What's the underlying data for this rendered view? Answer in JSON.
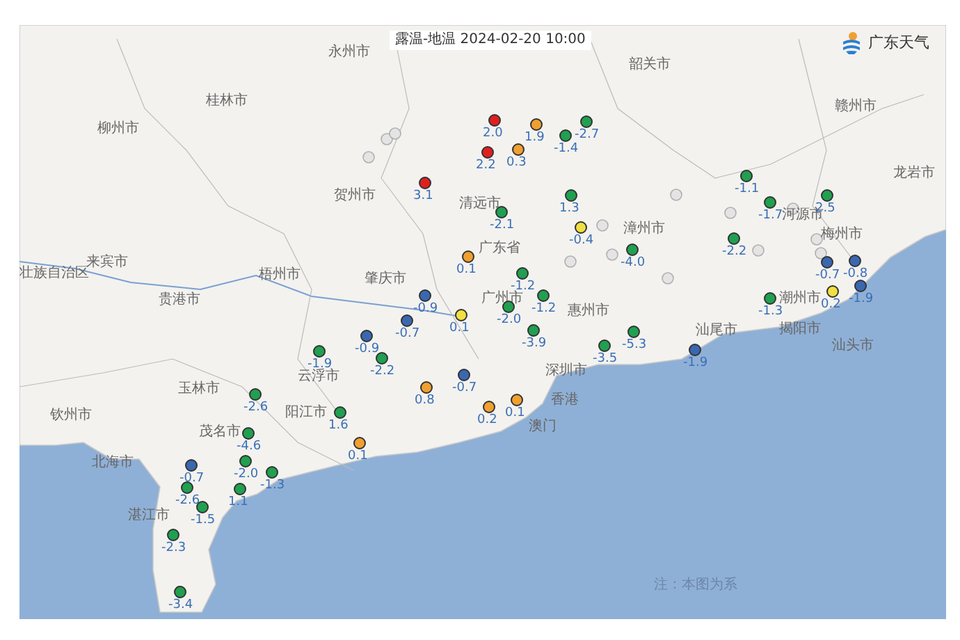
{
  "title": "露温-地温 2024-02-20 10:00",
  "logo": {
    "text": "广东天气"
  },
  "cities": [
    {
      "name": "永州市"
    },
    {
      "name": "桂林市"
    },
    {
      "name": "柳州市"
    },
    {
      "name": "贺州市"
    },
    {
      "name": "来宾市"
    },
    {
      "name": "壮族自治区"
    },
    {
      "name": "梧州市"
    },
    {
      "name": "贵港市"
    },
    {
      "name": "玉林市"
    },
    {
      "name": "钦州市"
    },
    {
      "name": "北海市"
    },
    {
      "name": "茂名市"
    },
    {
      "name": "湛江市"
    },
    {
      "name": "阳江市"
    },
    {
      "name": "云浮市"
    },
    {
      "name": "肇庆市"
    },
    {
      "name": "清远市"
    },
    {
      "name": "广东省"
    },
    {
      "name": "广州市"
    },
    {
      "name": "韶关市"
    },
    {
      "name": "赣州市"
    },
    {
      "name": "龙岩市"
    },
    {
      "name": "漳州市"
    },
    {
      "name": "河源市"
    },
    {
      "name": "梅州市"
    },
    {
      "name": "潮州市"
    },
    {
      "name": "揭阳市"
    },
    {
      "name": "汕头市"
    },
    {
      "name": "惠州市"
    },
    {
      "name": "汕尾市"
    },
    {
      "name": "深圳市"
    },
    {
      "name": "香港"
    },
    {
      "name": "澳门"
    }
  ],
  "stations": [
    {
      "value": "2.0",
      "color": "#e02020"
    },
    {
      "value": "1.9",
      "color": "#f0a030"
    },
    {
      "value": "-1.4",
      "color": "#20a050"
    },
    {
      "value": "-2.7",
      "color": "#20a050"
    },
    {
      "value": "2.2",
      "color": "#e02020"
    },
    {
      "value": "0.3",
      "color": "#f0a030"
    },
    {
      "value": "3.1",
      "color": "#e02020"
    },
    {
      "value": "-2.1",
      "color": "#20a050"
    },
    {
      "value": "1.3",
      "color": "#20a050"
    },
    {
      "value": "-0.4",
      "color": "#f0e040"
    },
    {
      "value": "-4.0",
      "color": "#20a050"
    },
    {
      "value": "-1.1",
      "color": "#20a050"
    },
    {
      "value": "-1.7",
      "color": "#20a050"
    },
    {
      "value": "2.5",
      "color": "#20a050"
    },
    {
      "value": "-2.2",
      "color": "#20a050"
    },
    {
      "value": "-1.3",
      "color": "#20a050"
    },
    {
      "value": "-0.7",
      "color": "#3a68b0"
    },
    {
      "value": "-0.8",
      "color": "#3a68b0"
    },
    {
      "value": "-1.9",
      "color": "#3a68b0"
    },
    {
      "value": "0.2",
      "color": "#f0e040"
    },
    {
      "value": "-1.2",
      "color": "#20a050"
    },
    {
      "value": "-1.2",
      "color": "#20a050"
    },
    {
      "value": "0.1",
      "color": "#f0a030"
    },
    {
      "value": "-0.9",
      "color": "#3a68b0"
    },
    {
      "value": "-0.7",
      "color": "#3a68b0"
    },
    {
      "value": "-0.9",
      "color": "#3a68b0"
    },
    {
      "value": "-1.9",
      "color": "#20a050"
    },
    {
      "value": "-2.2",
      "color": "#20a050"
    },
    {
      "value": "0.8",
      "color": "#f0a030"
    },
    {
      "value": "-0.7",
      "color": "#3a68b0"
    },
    {
      "value": "1.6",
      "color": "#20a050"
    },
    {
      "value": "0.1",
      "color": "#f0a030"
    },
    {
      "value": "-2.6",
      "color": "#20a050"
    },
    {
      "value": "-4.6",
      "color": "#20a050"
    },
    {
      "value": "-2.0",
      "color": "#20a050"
    },
    {
      "value": "-1.3",
      "color": "#20a050"
    },
    {
      "value": "1.1",
      "color": "#20a050"
    },
    {
      "value": "-0.7",
      "color": "#3a68b0"
    },
    {
      "value": "-2.6",
      "color": "#20a050"
    },
    {
      "value": "-1.5",
      "color": "#20a050"
    },
    {
      "value": "-2.3",
      "color": "#20a050"
    },
    {
      "value": "-3.4",
      "color": "#20a050"
    },
    {
      "value": "-3.9",
      "color": "#20a050"
    },
    {
      "value": "-3.5",
      "color": "#20a050"
    },
    {
      "value": "-5.3",
      "color": "#20a050"
    },
    {
      "value": "-1.9",
      "color": "#3a68b0"
    },
    {
      "value": "-2.0",
      "color": "#20a050"
    },
    {
      "value": "0.2",
      "color": "#f0a030"
    },
    {
      "value": "0.1",
      "color": "#f0a030"
    },
    {
      "value": "0.1",
      "color": "#f0e040"
    }
  ],
  "note": "注：本图为系"
}
